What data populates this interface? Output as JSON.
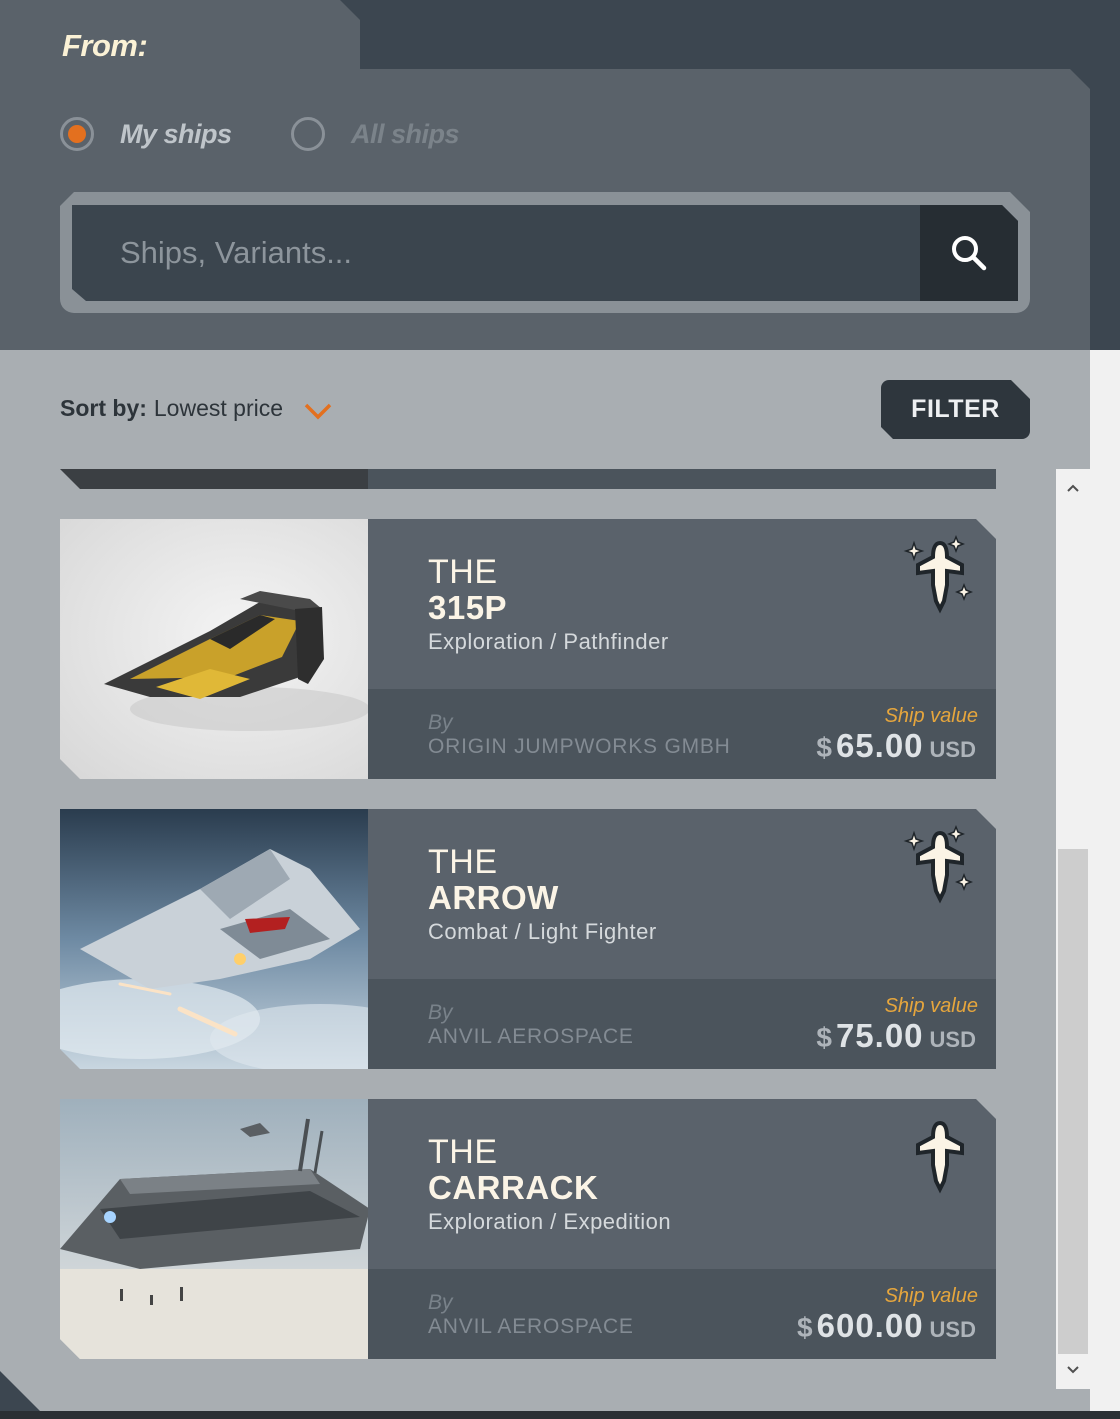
{
  "header": {
    "from_label": "From:",
    "radio_options": [
      {
        "label": "My ships",
        "selected": true
      },
      {
        "label": "All ships",
        "selected": false
      }
    ],
    "search": {
      "placeholder": "Ships, Variants..."
    }
  },
  "toolbar": {
    "sort_label": "Sort by:",
    "sort_value": "Lowest price",
    "filter_label": "FILTER"
  },
  "ships": [
    {
      "the": "THE",
      "name": "315P",
      "role": "Exploration / Pathfinder",
      "by": "By",
      "manufacturer": "ORIGIN JUMPWORKS GMBH",
      "value_label": "Ship value",
      "currency_symbol": "$",
      "price": "65.00",
      "currency": "USD",
      "badge_icon": "ship-sparkle-icon"
    },
    {
      "the": "THE",
      "name": "ARROW",
      "role": "Combat / Light Fighter",
      "by": "By",
      "manufacturer": "ANVIL AEROSPACE",
      "value_label": "Ship value",
      "currency_symbol": "$",
      "price": "75.00",
      "currency": "USD",
      "badge_icon": "ship-sparkle-icon"
    },
    {
      "the": "THE",
      "name": "CARRACK",
      "role": "Exploration / Expedition",
      "by": "By",
      "manufacturer": "ANVIL AEROSPACE",
      "value_label": "Ship value",
      "currency_symbol": "$",
      "price": "600.00",
      "currency": "USD",
      "badge_icon": "ship-icon"
    }
  ],
  "colors": {
    "accent": "#e3701f",
    "value_label": "#e6a63d",
    "panel": "#5a626a",
    "content_bg": "#a9aeb2"
  }
}
